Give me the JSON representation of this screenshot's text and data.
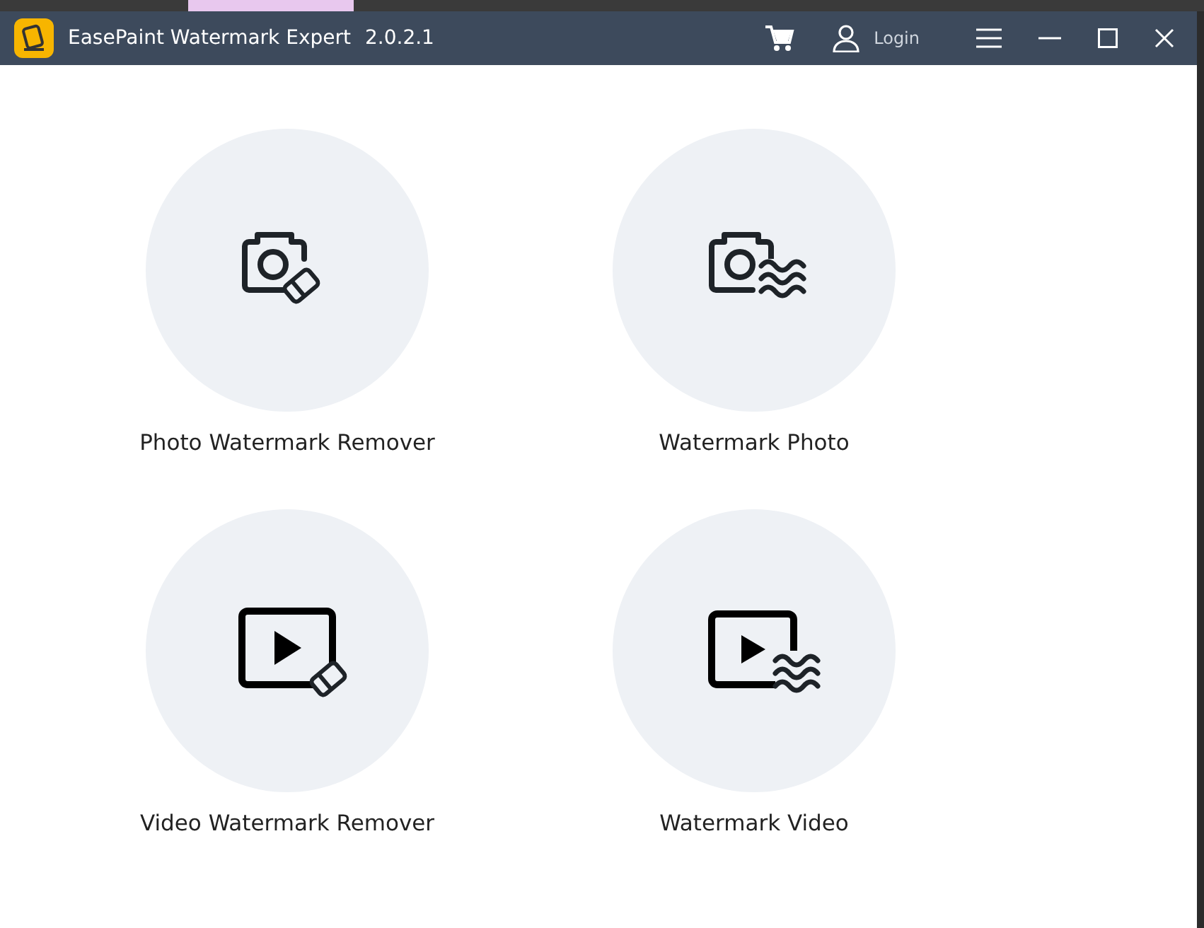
{
  "window": {
    "title": "EasePaint Watermark Expert",
    "version": "2.0.2.1",
    "login": "Login"
  },
  "tools": [
    {
      "label": "Photo Watermark Remover",
      "kind": "photo-eraser"
    },
    {
      "label": "Watermark Photo",
      "kind": "photo-waves"
    },
    {
      "label": "Video Watermark Remover",
      "kind": "video-eraser"
    },
    {
      "label": "Watermark Video",
      "kind": "video-waves"
    }
  ]
}
